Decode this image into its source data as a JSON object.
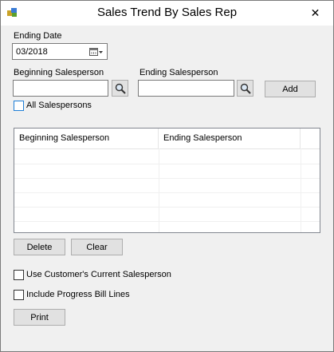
{
  "window": {
    "title": "Sales Trend By Sales Rep",
    "close_glyph": "✕"
  },
  "ending_date": {
    "label": "Ending Date",
    "value": "03/2018"
  },
  "beginning_salesperson": {
    "label": "Beginning Salesperson",
    "value": ""
  },
  "ending_salesperson": {
    "label": "Ending Salesperson",
    "value": ""
  },
  "buttons": {
    "add": "Add",
    "delete": "Delete",
    "clear": "Clear",
    "print": "Print"
  },
  "all_salespersons": {
    "label": "All Salespersons",
    "checked": false
  },
  "grid": {
    "columns": [
      "Beginning Salesperson",
      "Ending Salesperson"
    ],
    "rows": []
  },
  "options": {
    "use_current_salesperson": {
      "label": "Use Customer's Current Salesperson",
      "checked": false
    },
    "include_progress_bill": {
      "label": "Include Progress Bill Lines",
      "checked": false
    }
  },
  "icons": {
    "app": "app-icon",
    "calendar": "calendar-icon",
    "search": "search-icon",
    "close": "close-icon"
  }
}
